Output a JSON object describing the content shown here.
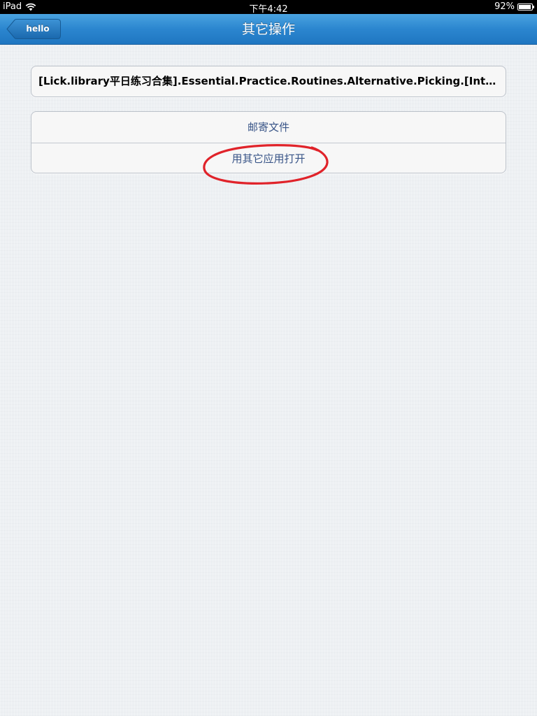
{
  "status_bar": {
    "carrier": "iPad",
    "time": "下午4:42",
    "battery_text": "92%",
    "battery_level": 0.92,
    "wifi_icon": "wifi-icon",
    "battery_icon": "battery-icon"
  },
  "nav": {
    "back_label": "hello",
    "title": "其它操作",
    "color": "#2b86cf"
  },
  "file": {
    "name": "[Lick.library平日练习合集].Essential.Practice.Routines.Alternative.Picking.[Intermediate]"
  },
  "actions": [
    {
      "label": "邮寄文件"
    },
    {
      "label": "用其它应用打开"
    }
  ],
  "annotation": {
    "color": "#e0232a",
    "target": "用其它应用打开"
  }
}
